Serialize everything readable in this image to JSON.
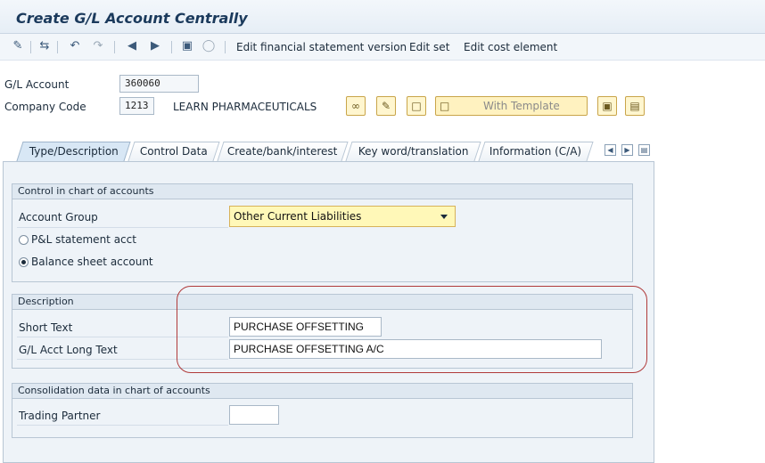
{
  "window": {
    "title": "Create G/L Account Centrally"
  },
  "toolbar": {
    "icons": [
      "change-icon",
      "switch-icon",
      "undo-icon",
      "redo-icon",
      "previous-icon",
      "next-icon",
      "save-icon",
      "delete-icon"
    ],
    "edit_fsv": "Edit financial statement version",
    "edit_set": "Edit set",
    "edit_cost_element": "Edit cost element"
  },
  "header": {
    "gl_account_label": "G/L Account",
    "gl_account_value": "360060",
    "company_code_label": "Company Code",
    "company_code_value": "1213",
    "company_name": "LEARN PHARMACEUTICALS",
    "with_template": "With Template"
  },
  "tabs": [
    {
      "label": "Type/Description",
      "active": true
    },
    {
      "label": "Control Data",
      "active": false
    },
    {
      "label": "Create/bank/interest",
      "active": false
    },
    {
      "label": "Key word/translation",
      "active": false
    },
    {
      "label": "Information (C/A)",
      "active": false
    }
  ],
  "control_group": {
    "title": "Control in chart of accounts",
    "account_group_label": "Account Group",
    "account_group_value": "Other Current Liabilities",
    "pl_label": "P&L statement acct",
    "bs_label": "Balance sheet account",
    "selected": "Balance sheet account"
  },
  "description_group": {
    "title": "Description",
    "short_text_label": "Short Text",
    "short_text_value": "PURCHASE OFFSETTING",
    "long_text_label": "G/L Acct Long Text",
    "long_text_value": "PURCHASE OFFSETTING A/C"
  },
  "consolidation_group": {
    "title": "Consolidation data in chart of accounts",
    "trading_partner_label": "Trading Partner",
    "trading_partner_value": ""
  },
  "colors": {
    "accent_yellow": "#fff8b8",
    "highlight_red": "#b03a3a",
    "panel_bg": "#eef3f8"
  }
}
